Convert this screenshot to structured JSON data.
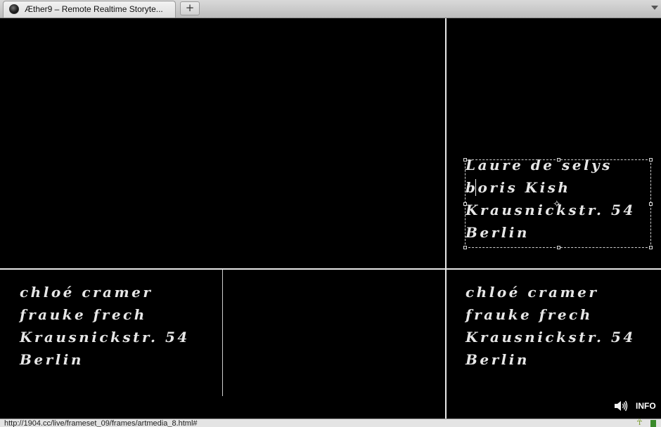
{
  "browser": {
    "tab": {
      "title": "Æther9 – Remote Realtime Storyte...",
      "favicon": "black-sphere-icon"
    },
    "new_tab_label": "+",
    "status_url": "http://1904.cc/live/frameset_09/frames/artmedia_8.html#"
  },
  "frames": {
    "top_right": {
      "lines": [
        "Laure de selys",
        "boris Kish",
        "Krausnickstr. 54",
        "Berlin"
      ]
    },
    "bottom_left": {
      "lines": [
        "chloé cramer",
        "frauke frech",
        "Krausnickstr. 54",
        "Berlin"
      ]
    },
    "bottom_right": {
      "lines": [
        "chloé cramer",
        "frauke frech",
        "Krausnickstr. 54",
        "Berlin"
      ],
      "info_label": "INFO",
      "speaker_icon": "speaker-icon"
    }
  },
  "colors": {
    "background": "#000000",
    "text": "#e6e6e6",
    "divider": "#e8e8e8"
  }
}
